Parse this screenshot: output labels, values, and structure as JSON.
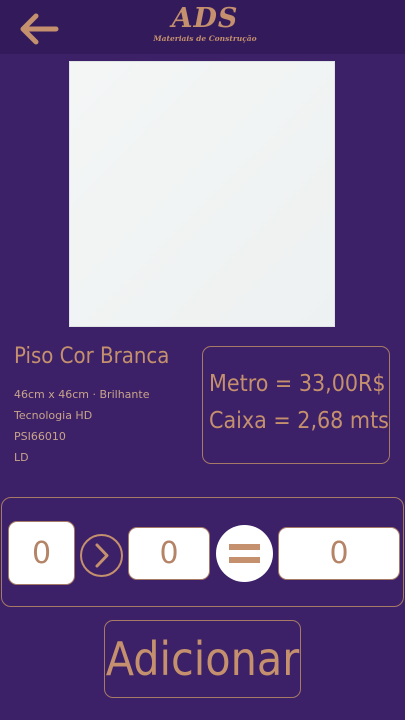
{
  "header": {
    "back_icon": "arrow-left-icon",
    "logo_main": "ADS",
    "logo_sub": "Materiais de Construção"
  },
  "product": {
    "image_icon": "white-tile-image",
    "title": "Piso Cor Branca",
    "details": [
      "46cm x 46cm  · Brilhante",
      "Tecnologia HD",
      "PSI66010",
      "LD"
    ]
  },
  "price": {
    "metro": "Metro = 33,00R$",
    "caixa": "Caixa = 2,68 mts"
  },
  "calculator": {
    "input_value": "0",
    "arrow_icon": "chevron-right-circle-icon",
    "middle_value": "0",
    "equals_icon": "equals-circle-icon",
    "result_value": "0"
  },
  "actions": {
    "add_label": "Adicionar"
  },
  "colors": {
    "background": "#3c2068",
    "header": "#331b5b",
    "accent": "#c4906d",
    "border": "#a77a66"
  }
}
